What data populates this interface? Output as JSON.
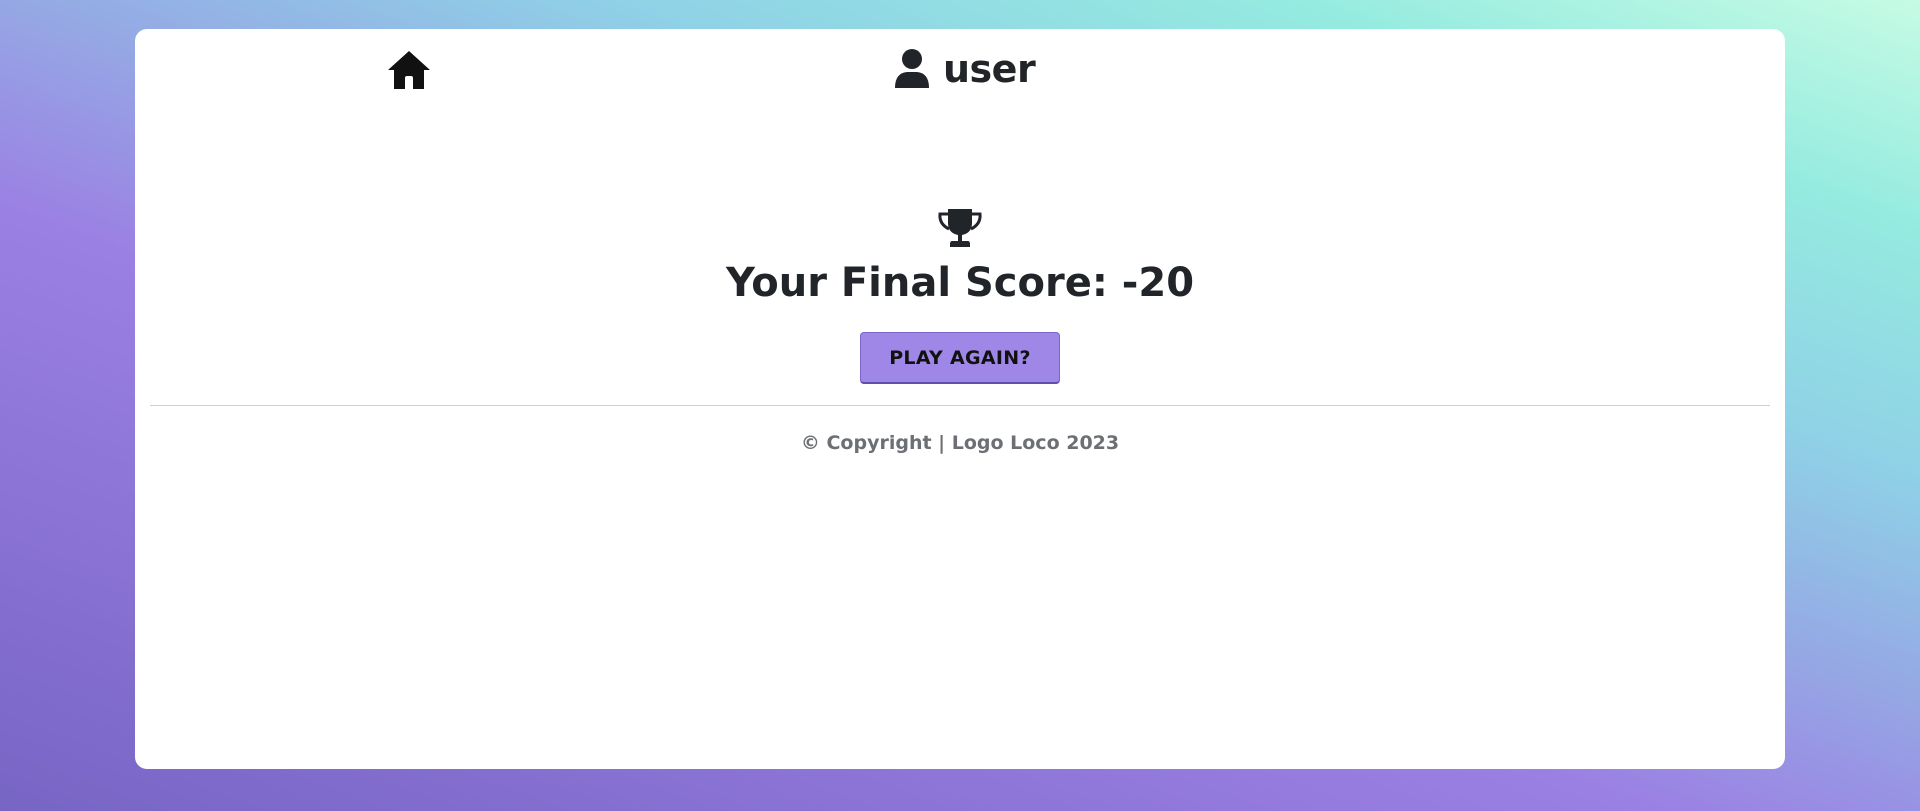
{
  "nav": {
    "home_icon": "home-icon",
    "user_icon": "user-icon",
    "username": "user"
  },
  "main": {
    "trophy_icon": "trophy-icon",
    "final_score_text": "Your Final Score: -20",
    "play_again_label": "PLAY AGAIN?"
  },
  "footer": {
    "copyright_text": "© Copyright | Logo Loco 2023"
  },
  "colors": {
    "button_bg": "#9e87e6",
    "text": "#212529",
    "footer_text": "#6c6f73"
  }
}
